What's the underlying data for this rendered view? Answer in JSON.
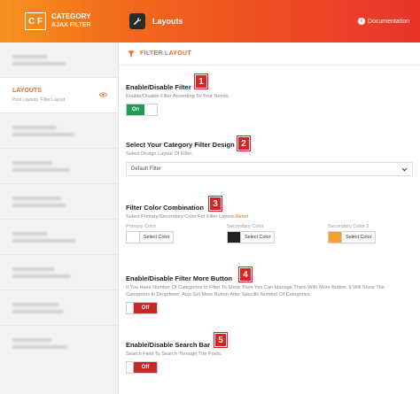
{
  "brand": {
    "logo_letters": "C F",
    "name_line1": "CATEGORY",
    "name_line2": "AJAX FILTER"
  },
  "topbar": {
    "title": "Layouts",
    "doc_label": "Documentation"
  },
  "sidebar": {
    "active": {
      "label": "LAYOUTS",
      "desc": "Post Layouts, Filter Layout"
    }
  },
  "main": {
    "section_title": "FILTER LAYOUT",
    "enable_filter": {
      "title": "Enable/Disable Filter",
      "desc": "Enable/Disable Filter According To Your Needs.",
      "toggle": "On",
      "badge": "1"
    },
    "design": {
      "title": "Select Your Category Filter Design",
      "desc": "Select Design Layout Of Filter.",
      "selected": "Default Filter",
      "badge": "2"
    },
    "colors": {
      "title": "Filter Color Combination",
      "desc": "Select Primary/Secondary Color For Filter Layout.",
      "reset": "Reset",
      "badge": "3",
      "items": [
        {
          "label": "Primary Color",
          "button": "Select Color",
          "color": "#ffffff"
        },
        {
          "label": "Secondary Color",
          "button": "Select Color",
          "color": "#222222"
        },
        {
          "label": "Secondary Color 2",
          "button": "Select Color",
          "color": "#f5a033"
        }
      ]
    },
    "more_button": {
      "title": "Enable/Disable Filter More Button",
      "desc": "If You Have Number Of Categories In Filter To Show Then You Can Manage Them With More Button. It Will Show The Categories In Dropdown. Also Set More Button After Specific Number Of Categories.",
      "toggle": "Off",
      "badge": "4"
    },
    "search_bar": {
      "title": "Enable/Disable Search Bar",
      "desc": "Search Field To Search Through The Posts.",
      "toggle": "Off",
      "badge": "5"
    }
  },
  "colors_theme": {
    "accent": "#f26a1b",
    "on": "#1f9d55",
    "off": "#c62828",
    "badge": "#e02020"
  }
}
